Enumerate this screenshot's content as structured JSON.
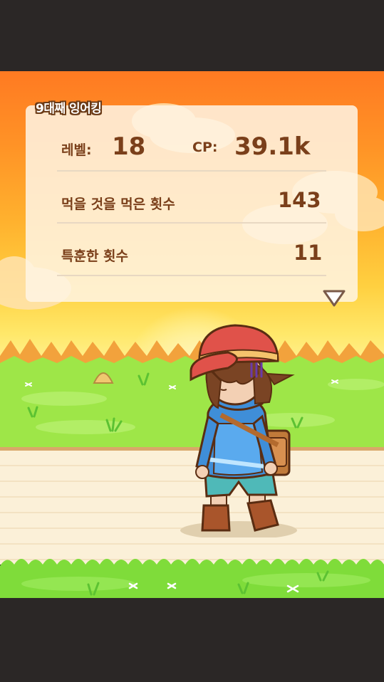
{
  "title": "9대째 잉어킹",
  "stats": {
    "level_label": "레벨:",
    "level_value": "18",
    "cp_label": "CP:",
    "cp_value": "39.1k",
    "eaten_label": "먹을 것을 먹은 횟수",
    "eaten_value": "143",
    "training_label": "특훈한 횟수",
    "training_value": "11"
  },
  "icons": {
    "expand": "triangle-down-icon"
  },
  "colors": {
    "sky_top": "#ff7a22",
    "sky_bottom": "#fff29a",
    "text_brown": "#7a3f1a",
    "grass": "#8ee04a",
    "road": "#fbf0d8",
    "letterbox": "#2b2726"
  }
}
